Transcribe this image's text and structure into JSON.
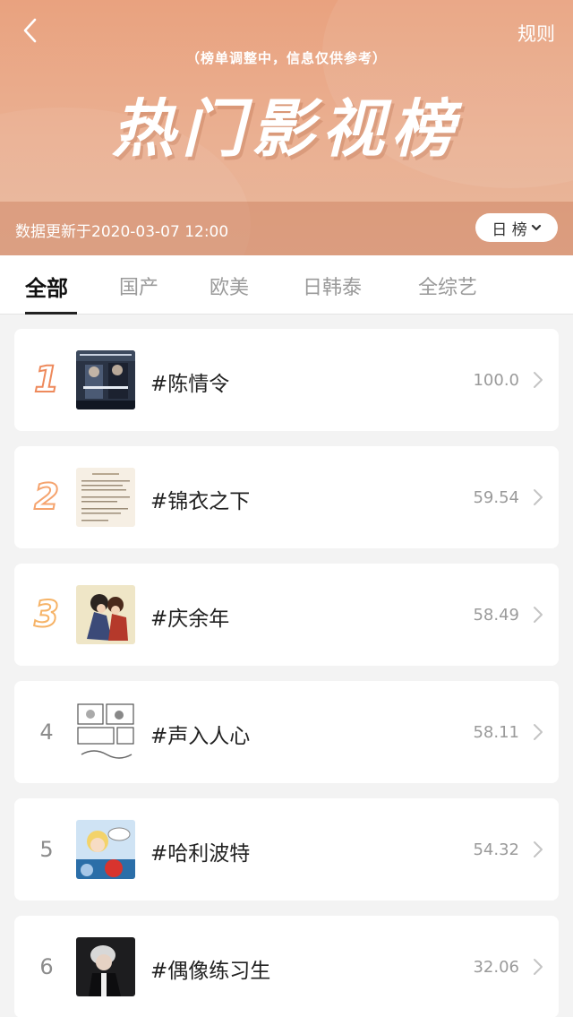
{
  "header": {
    "back_icon": "chevron-left-icon",
    "rules_label": "规则",
    "notice": "（榜单调整中，信息仅供参考）",
    "title": "热门影视榜",
    "update_text": "数据更新于2020-03-07 12:00",
    "period_select": {
      "value": "日 榜",
      "icon": "chevron-down-icon"
    }
  },
  "tabs": [
    {
      "label": "全部",
      "active": true
    },
    {
      "label": "国产",
      "active": false
    },
    {
      "label": "欧美",
      "active": false
    },
    {
      "label": "日韩泰",
      "active": false
    },
    {
      "label": "全综艺",
      "active": false
    }
  ],
  "ranking": [
    {
      "rank": "1",
      "name": "#陈情令",
      "score": "100.0"
    },
    {
      "rank": "2",
      "name": "#锦衣之下",
      "score": "59.54"
    },
    {
      "rank": "3",
      "name": "#庆余年",
      "score": "58.49"
    },
    {
      "rank": "4",
      "name": "#声入人心",
      "score": "58.11"
    },
    {
      "rank": "5",
      "name": "#哈利波特",
      "score": "54.32"
    },
    {
      "rank": "6",
      "name": "#偶像练习生",
      "score": "32.06"
    }
  ],
  "colors": {
    "header_top": "#e9a27f",
    "header_bottom": "#e8b79c",
    "rank1": "#ee8a5c",
    "rank2": "#f5a46f",
    "rank3": "#f6b367"
  }
}
